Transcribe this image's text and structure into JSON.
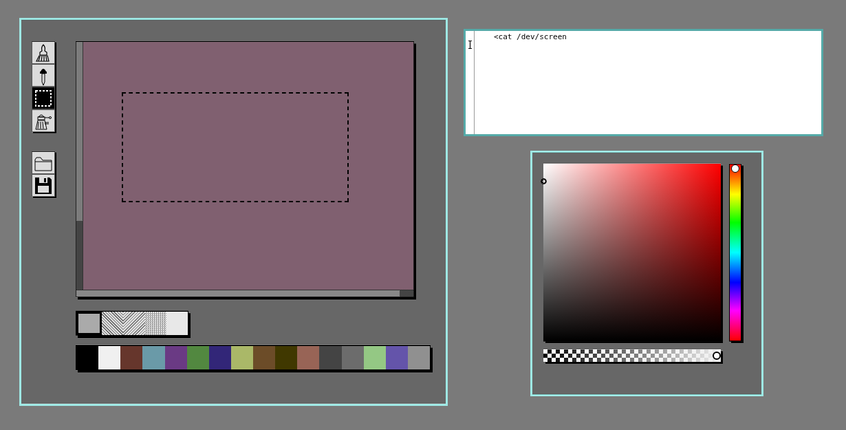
{
  "paint_window": {
    "tools": [
      {
        "kind": "brush",
        "selected": false
      },
      {
        "kind": "dropper",
        "selected": false
      },
      {
        "kind": "select",
        "selected": true
      },
      {
        "kind": "robot",
        "selected": false
      }
    ],
    "file_tools": [
      {
        "kind": "open"
      },
      {
        "kind": "save"
      }
    ],
    "canvas": {
      "color": "#806070"
    },
    "patterns": [
      {
        "kind": "fine",
        "selected": true
      },
      {
        "kind": "weave",
        "selected": false
      },
      {
        "kind": "zigzag",
        "selected": false
      },
      {
        "kind": "sparse",
        "selected": false
      },
      {
        "kind": "solid",
        "selected": false
      }
    ],
    "palette": [
      {
        "color": "#000000"
      },
      {
        "color": "#f0f0f0"
      },
      {
        "color": "#66362c"
      },
      {
        "color": "#6a9aa8"
      },
      {
        "color": "#6a3a84"
      },
      {
        "color": "#528840"
      },
      {
        "color": "#322678"
      },
      {
        "color": "#aab868"
      },
      {
        "color": "#6c4c28"
      },
      {
        "color": "#403800"
      },
      {
        "color": "#986456"
      },
      {
        "color": "#444444"
      },
      {
        "color": "#6c6c6c"
      },
      {
        "color": "#94c884"
      },
      {
        "color": "#6454aa"
      },
      {
        "color": "#909090"
      }
    ]
  },
  "terminal": {
    "lines": [
      "<cat /dev/screen"
    ]
  },
  "color_picker": {
    "hue": {
      "level": 0
    },
    "alpha": {
      "level": 1
    }
  }
}
